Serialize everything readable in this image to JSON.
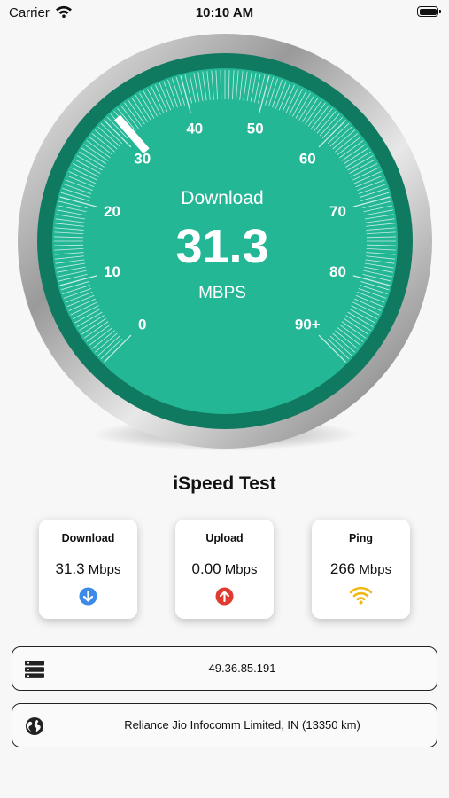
{
  "status_bar": {
    "carrier": "Carrier",
    "time": "10:10 AM"
  },
  "gauge": {
    "label": "Download",
    "value": "31.3",
    "unit": "MBPS",
    "ticks": [
      "0",
      "10",
      "20",
      "30",
      "40",
      "50",
      "60",
      "70",
      "80",
      "90+"
    ],
    "reading": 31.3,
    "colors": {
      "face": "#24b796",
      "ring": "#0f7a60",
      "needle": "#ffffff"
    }
  },
  "app_title": "iSpeed Test",
  "cards": [
    {
      "title": "Download",
      "value": "31.3",
      "unit": "Mbps",
      "icon": "arrow-down-circle-icon",
      "color": "#3d8ae8"
    },
    {
      "title": "Upload",
      "value": "0.00",
      "unit": "Mbps",
      "icon": "arrow-up-circle-icon",
      "color": "#e03b2f"
    },
    {
      "title": "Ping",
      "value": "266",
      "unit": "Mbps",
      "icon": "wifi-icon",
      "color": "#f2b711"
    }
  ],
  "server": {
    "icon": "server-icon",
    "ip": "49.36.85.191"
  },
  "isp": {
    "icon": "globe-icon",
    "text": "Reliance Jio Infocomm Limited, IN (13350 km)"
  }
}
